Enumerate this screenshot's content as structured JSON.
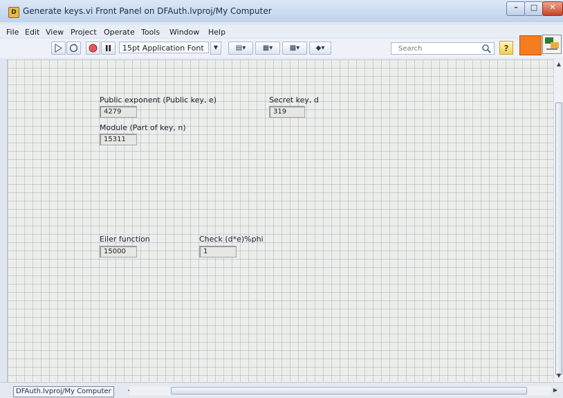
{
  "window": {
    "title": "Generate keys.vi Front Panel on DFAuth.lvproj/My Computer",
    "app_icon_glyph": "D"
  },
  "menu": [
    "File",
    "Edit",
    "View",
    "Project",
    "Operate",
    "Tools",
    "Window",
    "Help"
  ],
  "toolbar": {
    "font_select": "15pt Application Font",
    "search_placeholder": "Search",
    "help_glyph": "?"
  },
  "panel": {
    "public_exponent": {
      "label": "Public exponent (Public key, e)",
      "value": "4279"
    },
    "secret_key": {
      "label": "Secret key, d",
      "value": "319"
    },
    "module": {
      "label": "Module (Part of key, n)",
      "value": "15311"
    },
    "euler": {
      "label": "Eiler function",
      "value": "15000"
    },
    "check": {
      "label": "Check (d*e)%phi",
      "value": "1"
    }
  },
  "status": {
    "context": "DFAuth.lvproj/My Computer"
  },
  "colors": {
    "accent_orange": "#f57c1f",
    "panel_grid": "#eceeec"
  }
}
